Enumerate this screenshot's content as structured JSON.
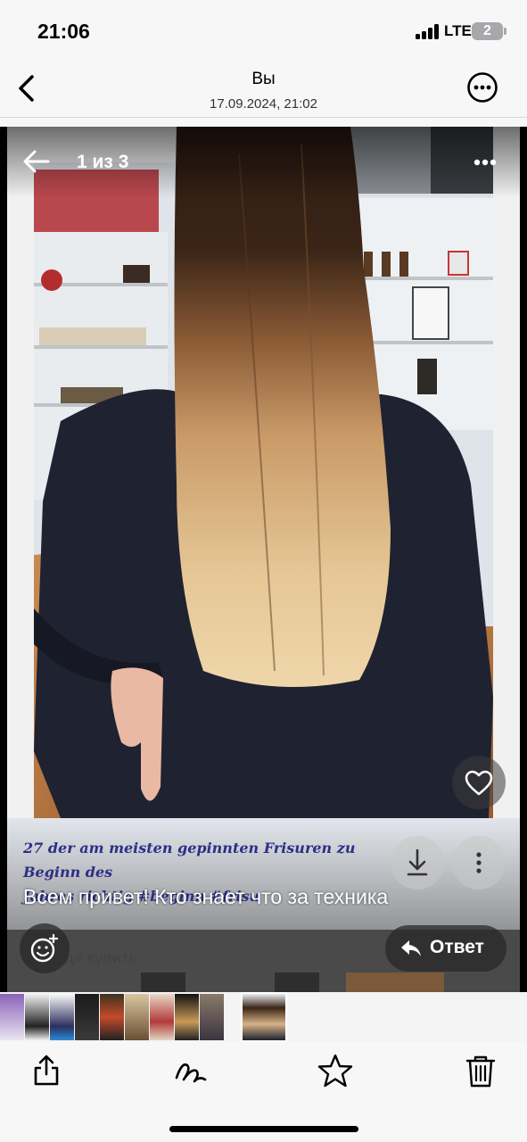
{
  "status_bar": {
    "time": "21:06",
    "network": "LTE",
    "battery": "2"
  },
  "header": {
    "title": "Вы",
    "subtitle": "17.09.2024, 21:02"
  },
  "viewer": {
    "counter": "1 из 3",
    "pin_caption_line1": "27 der am meisten gepinnten Frisuren zu Beginn des",
    "pin_caption_line2": "Jahres richtig #beginn #frisu",
    "message": "Всем привет! Кто знает что за техника",
    "shop_text": "где купить",
    "reply_label": "Ответ"
  },
  "thumbnails": {
    "count": 11,
    "active_index": 10
  },
  "colors": {
    "caption": "#2c2f86",
    "overlay_button": "#282828",
    "accent_icon": "#000000"
  },
  "icons": [
    "back-chevron-icon",
    "more-horizontal-icon",
    "arrow-left-icon",
    "heart-icon",
    "download-icon",
    "more-vertical-icon",
    "emoji-add-icon",
    "reply-arrow-icon",
    "share-icon",
    "markup-icon",
    "star-icon",
    "trash-icon"
  ]
}
